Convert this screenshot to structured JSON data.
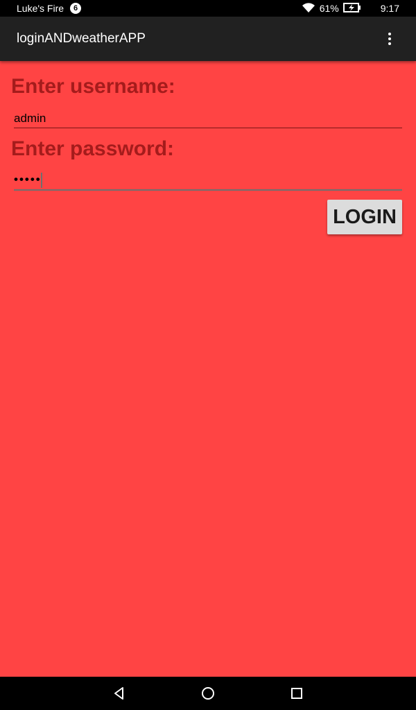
{
  "status_bar": {
    "carrier": "Luke's Fire",
    "notification_count": "6",
    "battery_percent": "61%",
    "time": "9:17",
    "icons": [
      "wifi-icon",
      "battery-charging-icon"
    ]
  },
  "app_bar": {
    "title": "loginANDweatherAPP",
    "menu_icon": "overflow-menu-icon"
  },
  "form": {
    "username_label": "Enter username:",
    "username_value": "admin",
    "password_label": "Enter password:",
    "password_value": "•••••",
    "login_label": "LOGIN"
  },
  "nav_bar": {
    "icons": [
      "back-icon",
      "home-icon",
      "recent-apps-icon"
    ]
  },
  "colors": {
    "background": "#ff4444",
    "label": "#a51c1c",
    "app_bar": "#212121",
    "button": "#dcdcdc"
  }
}
